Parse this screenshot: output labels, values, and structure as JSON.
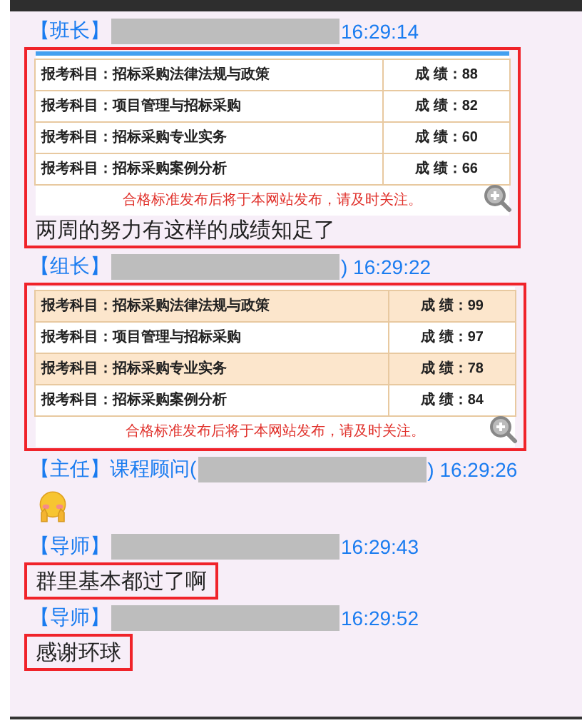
{
  "messages": [
    {
      "role": "【班长】",
      "time": "16:29:14",
      "highlighted": true,
      "content": {
        "kind": "plain_table",
        "rows": [
          {
            "subject": "报考科目：招标采购法律法规与政策",
            "score": "成 绩：88"
          },
          {
            "subject": "报考科目：项目管理与招标采购",
            "score": "成 绩：82"
          },
          {
            "subject": "报考科目：招标采购专业实务",
            "score": "成 绩：60"
          },
          {
            "subject": "报考科目：招标采购案例分析",
            "score": "成 绩：66"
          }
        ],
        "note": "合格标准发布后将于本网站发布，请及时关注。"
      },
      "text": "两周的努力有这样的成绩知足了"
    },
    {
      "role": "【组长】",
      "time": ") 16:29:22",
      "highlighted": true,
      "content": {
        "kind": "striped_table",
        "rows": [
          {
            "subject": "报考科目：招标采购法律法规与政策",
            "score": "成 绩：99"
          },
          {
            "subject": "报考科目：项目管理与招标采购",
            "score": "成 绩：97"
          },
          {
            "subject": "报考科目：招标采购专业实务",
            "score": "成 绩：78"
          },
          {
            "subject": "报考科目：招标采购案例分析",
            "score": "成 绩：84"
          }
        ],
        "note": "合格标准发布后将于本网站发布，请及时关注。"
      }
    },
    {
      "role": "【主任】",
      "name": "课程顾问(",
      "time": ") 16:29:26",
      "highlighted": false,
      "content": {
        "kind": "emoji"
      }
    },
    {
      "role": "【导师】",
      "time": "16:29:43",
      "highlighted": true,
      "text": "群里基本都过了啊"
    },
    {
      "role": "【导师】",
      "time": "16:29:52",
      "highlighted": true,
      "text": "感谢环球"
    }
  ]
}
